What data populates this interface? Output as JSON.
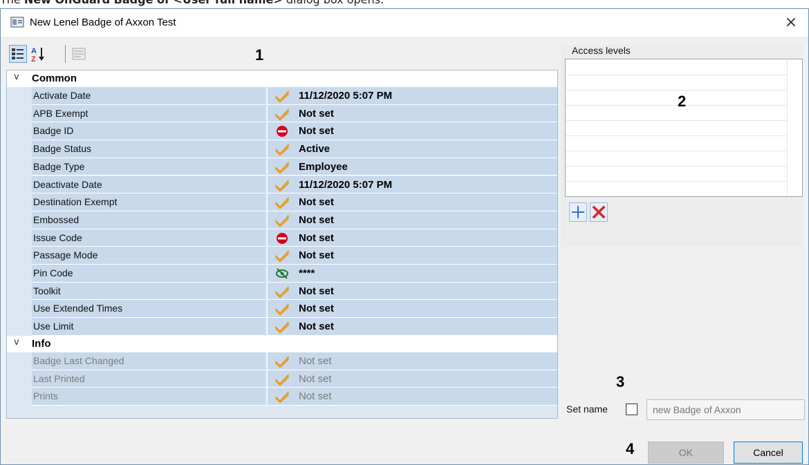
{
  "caption": {
    "prefix": "The ",
    "bold": "New OnGuard Badge of <User full name>",
    "suffix": " dialog box opens."
  },
  "dialog": {
    "title": "New Lenel Badge of Axxon Test",
    "close": "×"
  },
  "callouts": {
    "c1": "1",
    "c2": "2",
    "c3": "3",
    "c4": "4"
  },
  "toolbar": {
    "icons": [
      "categorized-icon",
      "alphabetical-sort-icon",
      "property-pages-icon"
    ]
  },
  "property_grid": {
    "categories": [
      {
        "label": "Common",
        "expanded": true,
        "rows": [
          {
            "name": "Activate Date",
            "icon": "check-icon",
            "value": "11/12/2020 5:07 PM"
          },
          {
            "name": "APB Exempt",
            "icon": "check-icon",
            "value": "Not set"
          },
          {
            "name": "Badge ID",
            "icon": "no-entry-icon",
            "value": "Not set"
          },
          {
            "name": "Badge Status",
            "icon": "check-icon",
            "value": "Active"
          },
          {
            "name": "Badge Type",
            "icon": "check-icon",
            "value": "Employee"
          },
          {
            "name": "Deactivate Date",
            "icon": "check-icon",
            "value": "11/12/2020 5:07 PM"
          },
          {
            "name": "Destination Exempt",
            "icon": "check-icon",
            "value": "Not set"
          },
          {
            "name": "Embossed",
            "icon": "check-icon",
            "value": "Not set"
          },
          {
            "name": "Issue Code",
            "icon": "no-entry-icon",
            "value": "Not set"
          },
          {
            "name": "Passage Mode",
            "icon": "check-icon",
            "value": "Not set"
          },
          {
            "name": "Pin Code",
            "icon": "eye-hidden-icon",
            "value": "****"
          },
          {
            "name": "Toolkit",
            "icon": "check-icon",
            "value": "Not set"
          },
          {
            "name": "Use Extended Times",
            "icon": "check-icon",
            "value": "Not set"
          },
          {
            "name": "Use Limit",
            "icon": "check-icon",
            "value": "Not set"
          }
        ]
      },
      {
        "label": "Info",
        "expanded": true,
        "rows": [
          {
            "name": "Badge Last Changed",
            "icon": "check-icon",
            "value": "Not set",
            "disabled": true
          },
          {
            "name": "Last Printed",
            "icon": "check-icon",
            "value": "Not set",
            "disabled": true
          },
          {
            "name": "Prints",
            "icon": "check-icon",
            "value": "Not set",
            "disabled": true
          }
        ]
      }
    ]
  },
  "access_levels": {
    "legend": "Access levels",
    "add_icon": "plus-icon",
    "remove_icon": "x-icon"
  },
  "set_name": {
    "label": "Set name",
    "checked": false,
    "placeholder": "new Badge of Axxon"
  },
  "buttons": {
    "ok": "OK",
    "cancel": "Cancel"
  },
  "colors": {
    "check": "#f5a623",
    "no_entry": "#d0021b",
    "eye_hidden": "#1e7a2e",
    "add": "#2f6fd6",
    "remove": "#d9262c",
    "grid_value_bg": "#c8d9eb"
  }
}
